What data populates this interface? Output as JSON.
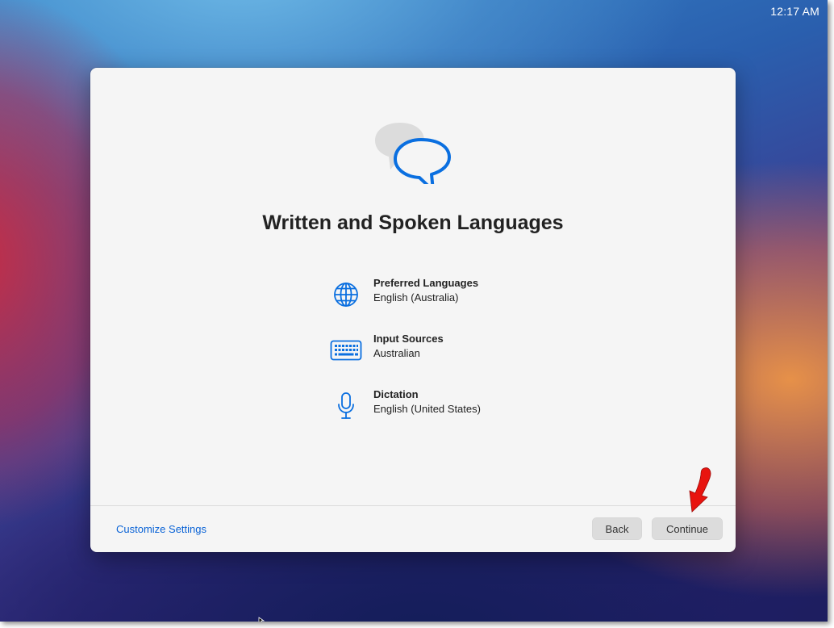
{
  "menubar": {
    "clock": "12:17 AM"
  },
  "dialog": {
    "title": "Written and Spoken Languages",
    "hero_icon": "speech-bubbles-icon",
    "accent_color": "#0a6fe0",
    "rows": [
      {
        "label": "Preferred Languages",
        "value": "English (Australia)",
        "icon": "globe-icon"
      },
      {
        "label": "Input Sources",
        "value": "Australian",
        "icon": "keyboard-icon"
      },
      {
        "label": "Dictation",
        "value": "English (United States)",
        "icon": "microphone-icon"
      }
    ],
    "footer": {
      "customize_link": "Customize Settings",
      "back_label": "Back",
      "continue_label": "Continue"
    }
  },
  "annotation": {
    "arrow_color": "#e8140f"
  }
}
